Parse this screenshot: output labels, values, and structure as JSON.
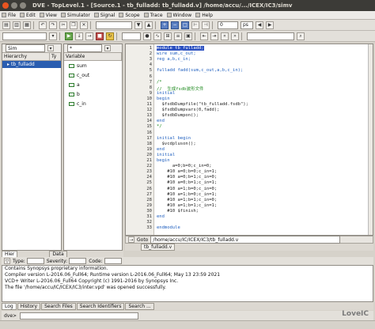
{
  "window": {
    "title": "DVE - TopLevel.1 - [Source.1 - tb_fulladd: tb_fulladd.v]  /home/accu/.../ICEX/IC3/simv"
  },
  "menu": [
    "File",
    "Edit",
    "View",
    "Simulator",
    "Signal",
    "Scope",
    "Trace",
    "Window",
    "Help"
  ],
  "toolbar": {
    "time_value": "0",
    "time_unit": "ps"
  },
  "hierarchy": {
    "combo_value": "Sim",
    "columns": [
      "Hierarchy",
      "Ty"
    ],
    "items": [
      {
        "label": "tb_fulladd",
        "selected": true
      }
    ]
  },
  "variables": {
    "combo_value": "*",
    "column": "Variable",
    "items": [
      "sum",
      "c_out",
      "a",
      "b",
      "c_in"
    ]
  },
  "editor": {
    "lines": [
      {
        "n": "1",
        "text": "module tb_fulladd;",
        "cls": "hl"
      },
      {
        "n": "2",
        "text": "wire sum,c_out;",
        "cls": "kw"
      },
      {
        "n": "3",
        "text": "reg a,b,c_in;",
        "cls": "kw"
      },
      {
        "n": "4",
        "text": "",
        "cls": "tx"
      },
      {
        "n": "5",
        "text": "fulladd fadd(sum,c_out,a,b,c_in);",
        "cls": "kw"
      },
      {
        "n": "6",
        "text": "",
        "cls": "tx"
      },
      {
        "n": "7",
        "text": "/*",
        "cls": "cm"
      },
      {
        "n": "8",
        "text": "//  生成fsdb波形文件",
        "cls": "cm"
      },
      {
        "n": "9",
        "text": "initial",
        "cls": "kw"
      },
      {
        "n": "10",
        "text": "begin",
        "cls": "kw"
      },
      {
        "n": "11",
        "text": "  $fsdbDumpfile(\"tb_fulladd.fsdb\");",
        "cls": "tx"
      },
      {
        "n": "12",
        "text": "  $fsdbDumpvars(0,fadd);",
        "cls": "tx"
      },
      {
        "n": "13",
        "text": "  $fsdbDumpon();",
        "cls": "tx"
      },
      {
        "n": "14",
        "text": "end",
        "cls": "kw"
      },
      {
        "n": "15",
        "text": "*/",
        "cls": "cm"
      },
      {
        "n": "16",
        "text": "",
        "cls": "tx"
      },
      {
        "n": "17",
        "text": "initial begin",
        "cls": "kw"
      },
      {
        "n": "18",
        "text": "  $vcdpluson();",
        "cls": "tx"
      },
      {
        "n": "19",
        "text": "end",
        "cls": "kw"
      },
      {
        "n": "20",
        "text": "initial",
        "cls": "kw"
      },
      {
        "n": "21",
        "text": "begin",
        "cls": "kw"
      },
      {
        "n": "22",
        "text": "      a=0;b=0;c_in=0;",
        "cls": "tx"
      },
      {
        "n": "23",
        "text": "    #10 a=0;b=0;c_in=1;",
        "cls": "tx"
      },
      {
        "n": "24",
        "text": "    #10 a=0;b=1;c_in=0;",
        "cls": "tx"
      },
      {
        "n": "25",
        "text": "    #10 a=0;b=1;c_in=1;",
        "cls": "tx"
      },
      {
        "n": "26",
        "text": "    #10 a=1;b=0;c_in=0;",
        "cls": "tx"
      },
      {
        "n": "27",
        "text": "    #10 a=1;b=0;c_in=1;",
        "cls": "tx"
      },
      {
        "n": "28",
        "text": "    #10 a=1;b=1;c_in=0;",
        "cls": "tx"
      },
      {
        "n": "29",
        "text": "    #10 a=1;b=1;c_in=1;",
        "cls": "tx"
      },
      {
        "n": "30",
        "text": "    #10 $finish;",
        "cls": "tx"
      },
      {
        "n": "31",
        "text": "end",
        "cls": "kw"
      },
      {
        "n": "32",
        "text": "",
        "cls": "tx"
      },
      {
        "n": "33",
        "text": "endmodule",
        "cls": "kw"
      }
    ],
    "go_label": "Goto",
    "path": "/home/accu/IC/ICEX/IC3/tb_fulladd.v",
    "tab_label": "tb_fulladd.v"
  },
  "left_tabs": {
    "hier": "Hier",
    "data": "Data"
  },
  "log": {
    "type_label": "Type:",
    "severity_label": "Severity:",
    "code_label": "Code:",
    "lines": [
      "Contains Synopsys proprietary information.",
      "Compiler version L-2016.06_Full64; Runtime version L-2016.06_Full64;  May 13 23:59 2021",
      "VCD+ Writer L-2016.06_Full64 Copyright (c) 1991-2016 by Synopsys Inc.",
      "The file '/home/accu/IC/ICEX/IC3/inter.vpd' was opened successfully."
    ]
  },
  "bottom_tabs": [
    "Log",
    "History",
    "Search Files",
    "Search Identifiers",
    "Search ..."
  ],
  "command": {
    "label": "dve>"
  },
  "watermark": "LoveIC"
}
